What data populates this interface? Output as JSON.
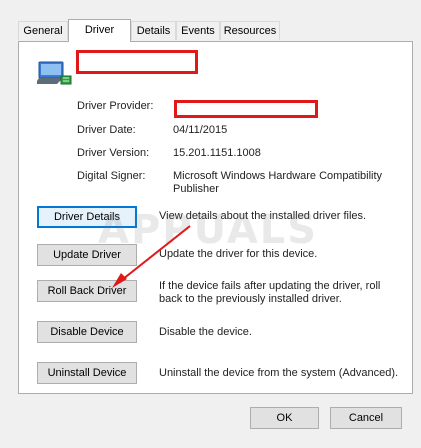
{
  "tabs": [
    "General",
    "Driver",
    "Details",
    "Events",
    "Resources"
  ],
  "active_tab": "Driver",
  "info": {
    "provider_label": "Driver Provider:",
    "date_label": "Driver Date:",
    "date_value": "04/11/2015",
    "version_label": "Driver Version:",
    "version_value": "15.201.1151.1008",
    "signer_label": "Digital Signer:",
    "signer_value": "Microsoft Windows Hardware Compatibility Publisher"
  },
  "actions": {
    "details_label": "Driver Details",
    "details_desc": "View details about the installed driver files.",
    "update_label": "Update Driver",
    "update_desc": "Update the driver for this device.",
    "rollback_label": "Roll Back Driver",
    "rollback_desc": "If the device fails after updating the driver, roll back to the previously installed driver.",
    "disable_label": "Disable Device",
    "disable_desc": "Disable the device.",
    "uninstall_label": "Uninstall Device",
    "uninstall_desc": "Uninstall the device from the system (Advanced)."
  },
  "watermark": "APPUALS",
  "footer": {
    "ok_label": "OK",
    "cancel_label": "Cancel"
  },
  "colors": {
    "redact": "#e01818",
    "arrow": "#e01818",
    "focus": "#0078d7"
  },
  "icons": {
    "device": "network-adapter-icon"
  }
}
